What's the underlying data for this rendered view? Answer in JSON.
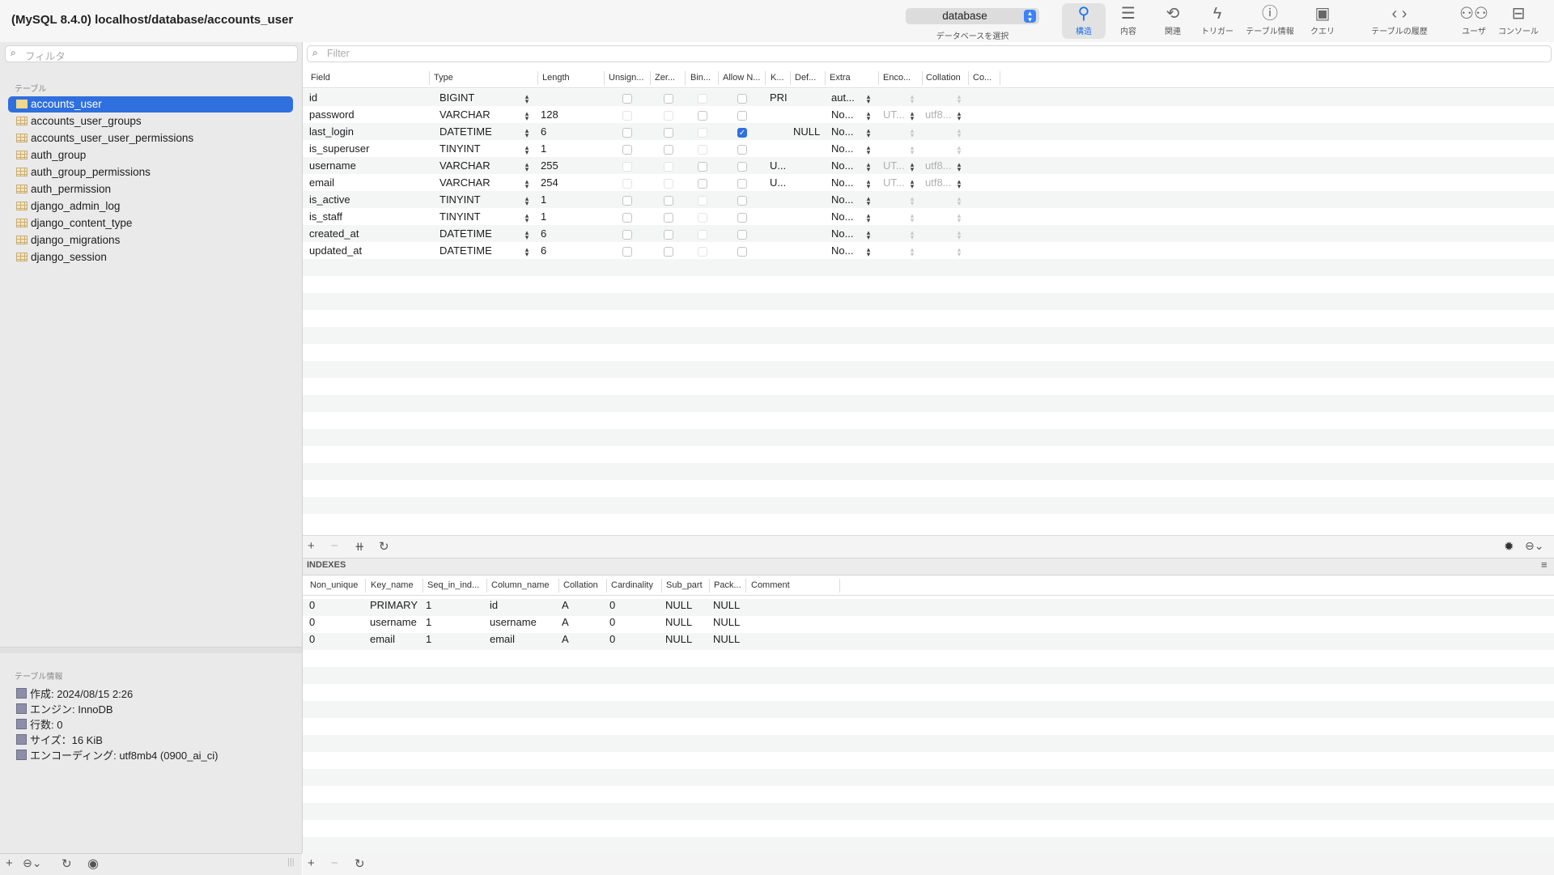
{
  "window": {
    "title": "(MySQL 8.4.0) localhost/database/accounts_user"
  },
  "database_selector": {
    "value": "database",
    "caption": "データベースを選択"
  },
  "toolbar": [
    {
      "name": "structure",
      "icon": "structure-icon",
      "label": "構造",
      "active": true
    },
    {
      "name": "content",
      "icon": "list-icon",
      "label": "内容",
      "active": false
    },
    {
      "name": "relations",
      "icon": "relations-icon",
      "label": "関連",
      "active": false
    },
    {
      "name": "triggers",
      "icon": "bolt-icon",
      "label": "トリガー",
      "active": false
    },
    {
      "name": "table-info",
      "icon": "info-icon",
      "label": "テーブル情報",
      "active": false
    },
    {
      "name": "query",
      "icon": "terminal-icon",
      "label": "クエリ",
      "active": false
    },
    {
      "name": "history",
      "icon": "chevron-icons",
      "label": "テーブルの履歴",
      "active": false
    },
    {
      "name": "users",
      "icon": "users-icon",
      "label": "ユーザ",
      "active": false
    },
    {
      "name": "console",
      "icon": "console-icon",
      "label": "コンソール",
      "active": false
    }
  ],
  "sidebar": {
    "filter_placeholder": "フィルタ",
    "section_title": "テーブル",
    "tables": [
      "accounts_user",
      "accounts_user_groups",
      "accounts_user_user_permissions",
      "auth_group",
      "auth_group_permissions",
      "auth_permission",
      "django_admin_log",
      "django_content_type",
      "django_migrations",
      "django_session"
    ],
    "selected_table": "accounts_user",
    "info_title": "テーブル情報",
    "info_items": [
      "作成: 2024/08/15 2:26",
      "エンジン: InnoDB",
      "行数: 0",
      "サイズ：16 KiB",
      "エンコーディング: utf8mb4 (0900_ai_ci)"
    ]
  },
  "structure": {
    "filter_placeholder": "Filter",
    "columns": [
      "Field",
      "Type",
      "Length",
      "Unsign...",
      "Zer...",
      "Bin...",
      "Allow N...",
      "K...",
      "Def...",
      "Extra",
      "Enco...",
      "Collation",
      "Co..."
    ],
    "rows": [
      {
        "field": "id",
        "type": "BIGINT",
        "length": "",
        "unsigned": false,
        "zerofill": false,
        "binary": false,
        "allow_null": false,
        "key": "PRI",
        "default": "",
        "extra": "aut...",
        "encoding": "",
        "collation": ""
      },
      {
        "field": "password",
        "type": "VARCHAR",
        "length": "128",
        "unsigned": false,
        "zerofill": false,
        "binary": false,
        "allow_null": false,
        "key": "",
        "default": "",
        "extra": "No...",
        "encoding": "UT...",
        "collation": "utf8..."
      },
      {
        "field": "last_login",
        "type": "DATETIME",
        "length": "6",
        "unsigned": false,
        "zerofill": false,
        "binary": false,
        "allow_null": true,
        "key": "",
        "default": "NULL",
        "extra": "No...",
        "encoding": "",
        "collation": ""
      },
      {
        "field": "is_superuser",
        "type": "TINYINT",
        "length": "1",
        "unsigned": false,
        "zerofill": false,
        "binary": false,
        "allow_null": false,
        "key": "",
        "default": "",
        "extra": "No...",
        "encoding": "",
        "collation": ""
      },
      {
        "field": "username",
        "type": "VARCHAR",
        "length": "255",
        "unsigned": false,
        "zerofill": false,
        "binary": false,
        "allow_null": false,
        "key": "U...",
        "default": "",
        "extra": "No...",
        "encoding": "UT...",
        "collation": "utf8..."
      },
      {
        "field": "email",
        "type": "VARCHAR",
        "length": "254",
        "unsigned": false,
        "zerofill": false,
        "binary": false,
        "allow_null": false,
        "key": "U...",
        "default": "",
        "extra": "No...",
        "encoding": "UT...",
        "collation": "utf8..."
      },
      {
        "field": "is_active",
        "type": "TINYINT",
        "length": "1",
        "unsigned": false,
        "zerofill": false,
        "binary": false,
        "allow_null": false,
        "key": "",
        "default": "",
        "extra": "No...",
        "encoding": "",
        "collation": ""
      },
      {
        "field": "is_staff",
        "type": "TINYINT",
        "length": "1",
        "unsigned": false,
        "zerofill": false,
        "binary": false,
        "allow_null": false,
        "key": "",
        "default": "",
        "extra": "No...",
        "encoding": "",
        "collation": ""
      },
      {
        "field": "created_at",
        "type": "DATETIME",
        "length": "6",
        "unsigned": false,
        "zerofill": false,
        "binary": false,
        "allow_null": false,
        "key": "",
        "default": "",
        "extra": "No...",
        "encoding": "",
        "collation": ""
      },
      {
        "field": "updated_at",
        "type": "DATETIME",
        "length": "6",
        "unsigned": false,
        "zerofill": false,
        "binary": false,
        "allow_null": false,
        "key": "",
        "default": "",
        "extra": "No...",
        "encoding": "",
        "collation": ""
      }
    ]
  },
  "indexes": {
    "title": "INDEXES",
    "columns": [
      "Non_unique",
      "Key_name",
      "Seq_in_ind...",
      "Column_name",
      "Collation",
      "Cardinality",
      "Sub_part",
      "Pack...",
      "Comment"
    ],
    "rows": [
      [
        "0",
        "PRIMARY",
        "1",
        "id",
        "A",
        "0",
        "NULL",
        "NULL",
        ""
      ],
      [
        "0",
        "username",
        "1",
        "username",
        "A",
        "0",
        "NULL",
        "NULL",
        ""
      ],
      [
        "0",
        "email",
        "1",
        "email",
        "A",
        "0",
        "NULL",
        "NULL",
        ""
      ]
    ]
  },
  "colors": {
    "accent": "#2f6fde",
    "active_tool": "#1a6ff0"
  }
}
